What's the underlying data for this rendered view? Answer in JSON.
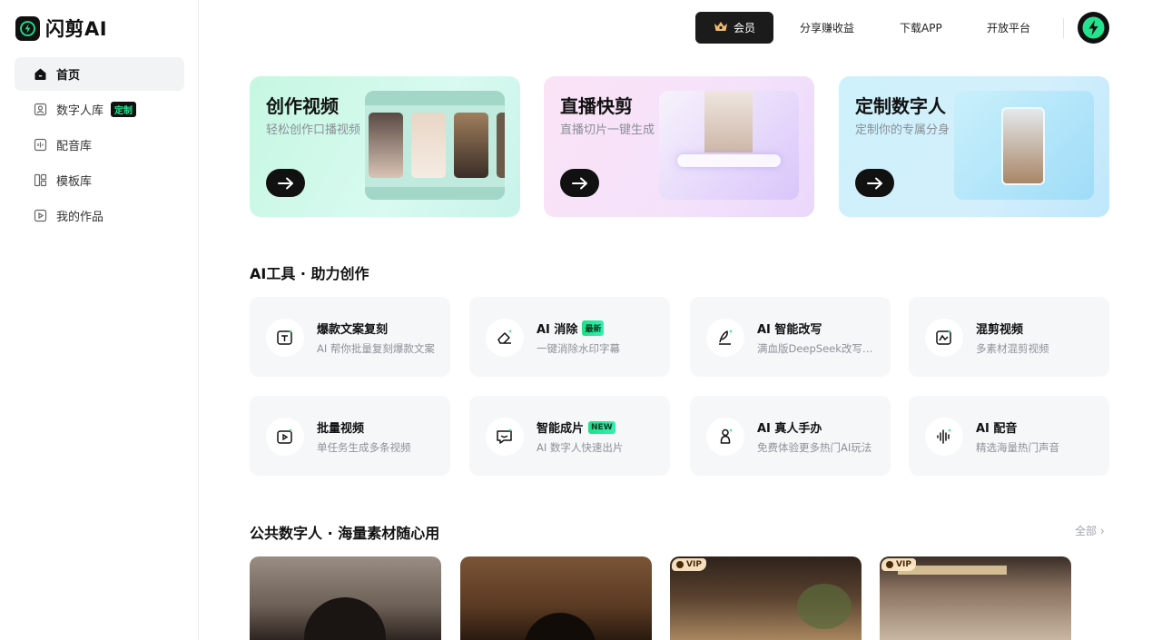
{
  "brand": {
    "name": "闪剪AI",
    "accent": "#23e38f"
  },
  "sidebar": {
    "items": [
      {
        "label": "首页",
        "icon": "home-icon",
        "active": true
      },
      {
        "label": "数字人库",
        "icon": "digital-human-icon",
        "tag": "定制"
      },
      {
        "label": "配音库",
        "icon": "voice-library-icon"
      },
      {
        "label": "模板库",
        "icon": "template-icon"
      },
      {
        "label": "我的作品",
        "icon": "my-works-icon"
      }
    ]
  },
  "header": {
    "vip_label": "会员",
    "links": [
      "分享赚收益",
      "下载APP",
      "开放平台"
    ]
  },
  "features": [
    {
      "title": "创作视频",
      "subtitle": "轻松创作口播视频"
    },
    {
      "title": "直播快剪",
      "subtitle": "直播切片一键生成"
    },
    {
      "title": "定制数字人",
      "subtitle": "定制你的专属分身"
    }
  ],
  "tools_section": {
    "title": "AI工具 · 助力创作"
  },
  "tools": [
    {
      "name": "爆款文案复刻",
      "desc": "AI 帮你批量复刻爆款文案",
      "icon": "text-copy-icon"
    },
    {
      "name": "AI 消除",
      "badge": "最新",
      "desc": "一键消除水印字幕",
      "icon": "eraser-icon"
    },
    {
      "name": "AI 智能改写",
      "desc": "满血版DeepSeek改写文案",
      "icon": "rewrite-pen-icon"
    },
    {
      "name": "混剪视频",
      "desc": "多素材混剪视频",
      "icon": "mix-video-icon"
    },
    {
      "name": "批量视频",
      "desc": "单任务生成多条视频",
      "icon": "batch-video-icon"
    },
    {
      "name": "智能成片",
      "badge": "NEW",
      "desc": "AI 数字人快速出片",
      "icon": "smart-film-icon"
    },
    {
      "name": "AI 真人手办",
      "desc": "免费体验更多热门AI玩法",
      "icon": "figurine-icon"
    },
    {
      "name": "AI 配音",
      "desc": "精选海量热门声音",
      "icon": "voiceover-icon"
    }
  ],
  "public_section": {
    "title": "公共数字人 · 海量素材随心用",
    "all_label": "全部"
  },
  "public_avatars": [
    {
      "vip": false
    },
    {
      "vip": false
    },
    {
      "vip": true,
      "tag": "VIP"
    },
    {
      "vip": true,
      "tag": "VIP"
    }
  ]
}
